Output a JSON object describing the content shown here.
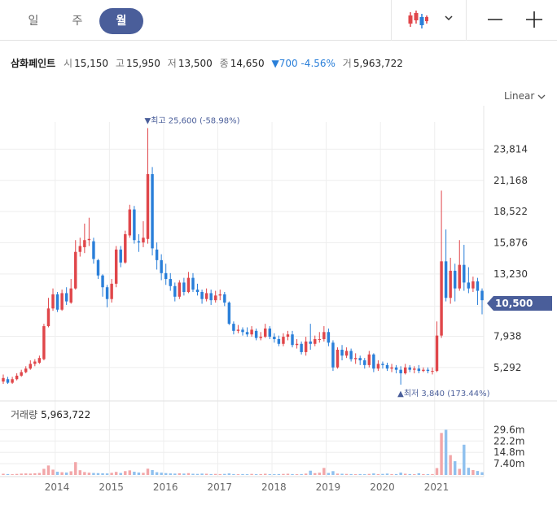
{
  "toolbar": {
    "periods": [
      {
        "label": "일",
        "active": false
      },
      {
        "label": "주",
        "active": false
      },
      {
        "label": "월",
        "active": true
      }
    ],
    "chart_type_icon": "candlestick-icon",
    "zoom_out_icon": "minus-icon",
    "zoom_in_icon": "plus-icon"
  },
  "quote": {
    "name": "삼화페인트",
    "open_label": "시",
    "open": "15,150",
    "high_label": "고",
    "high": "15,950",
    "low_label": "저",
    "low": "13,500",
    "close_label": "종",
    "close": "14,650",
    "change": "▼700 -4.56%",
    "volume_label": "거",
    "volume": "5,963,722"
  },
  "scale_mode": "Linear",
  "annotations": {
    "high": "▼최고 25,600 (-58.98%)",
    "low": "▲최저 3,840 (173.44%)"
  },
  "current_price_tag": "10,500",
  "volume_panel": {
    "label": "거래량",
    "value": "5,963,722"
  },
  "colors": {
    "up": "#e0464a",
    "down": "#2a7fd9",
    "vol_up": "#f2a6a8",
    "vol_down": "#8fc0ee",
    "accent": "#4a5e9a",
    "grid": "#eeeeee"
  },
  "chart_data": {
    "type": "candlestick",
    "y_ticks": [
      "23,814",
      "21,168",
      "18,522",
      "15,876",
      "13,230",
      "10,500",
      "7,938",
      "5,292"
    ],
    "volume_ticks": [
      "29.6m",
      "22.2m",
      "14.8m",
      "7.40m"
    ],
    "x_ticks": [
      "2014",
      "2015",
      "2016",
      "2017",
      "2018",
      "2019",
      "2020",
      "2021"
    ],
    "ylim": [
      2800,
      27500
    ],
    "volume_max_m": 33,
    "grid": true,
    "candles": [
      {
        "o": 4100,
        "c": 4400,
        "h": 4700,
        "l": 3900
      },
      {
        "o": 4300,
        "c": 4000,
        "h": 4500,
        "l": 3900
      },
      {
        "o": 4000,
        "c": 4300,
        "h": 4500,
        "l": 3900
      },
      {
        "o": 4300,
        "c": 4600,
        "h": 4800,
        "l": 4200
      },
      {
        "o": 4600,
        "c": 4900,
        "h": 5100,
        "l": 4500
      },
      {
        "o": 4900,
        "c": 5200,
        "h": 5400,
        "l": 4800
      },
      {
        "o": 5200,
        "c": 5600,
        "h": 5900,
        "l": 5100
      },
      {
        "o": 5600,
        "c": 5800,
        "h": 6000,
        "l": 5400
      },
      {
        "o": 5700,
        "c": 6100,
        "h": 6300,
        "l": 5600
      },
      {
        "o": 6000,
        "c": 8800,
        "h": 9000,
        "l": 5900
      },
      {
        "o": 8800,
        "c": 10300,
        "h": 11200,
        "l": 8700
      },
      {
        "o": 10300,
        "c": 11500,
        "h": 12000,
        "l": 10100
      },
      {
        "o": 11500,
        "c": 10200,
        "h": 11700,
        "l": 10000
      },
      {
        "o": 10200,
        "c": 11600,
        "h": 11900,
        "l": 10100
      },
      {
        "o": 11600,
        "c": 10900,
        "h": 12100,
        "l": 10600
      },
      {
        "o": 10800,
        "c": 12000,
        "h": 12800,
        "l": 10700
      },
      {
        "o": 12000,
        "c": 15100,
        "h": 16100,
        "l": 11900
      },
      {
        "o": 15100,
        "c": 15600,
        "h": 16300,
        "l": 14700
      },
      {
        "o": 15500,
        "c": 16100,
        "h": 17500,
        "l": 15000
      },
      {
        "o": 16100,
        "c": 16200,
        "h": 18000,
        "l": 15600
      },
      {
        "o": 16000,
        "c": 14500,
        "h": 16300,
        "l": 14100
      },
      {
        "o": 14400,
        "c": 13100,
        "h": 14500,
        "l": 12800
      },
      {
        "o": 13100,
        "c": 12100,
        "h": 13200,
        "l": 11300
      },
      {
        "o": 12100,
        "c": 11100,
        "h": 12300,
        "l": 10400
      },
      {
        "o": 11100,
        "c": 12400,
        "h": 12800,
        "l": 10800
      },
      {
        "o": 12400,
        "c": 15300,
        "h": 15600,
        "l": 12100
      },
      {
        "o": 15300,
        "c": 14200,
        "h": 15600,
        "l": 13800
      },
      {
        "o": 14200,
        "c": 16600,
        "h": 16900,
        "l": 14100
      },
      {
        "o": 16500,
        "c": 18700,
        "h": 19100,
        "l": 16300
      },
      {
        "o": 18700,
        "c": 16100,
        "h": 19000,
        "l": 15800
      },
      {
        "o": 16000,
        "c": 15900,
        "h": 16600,
        "l": 15100
      },
      {
        "o": 15900,
        "c": 16300,
        "h": 17700,
        "l": 15500
      },
      {
        "o": 16200,
        "c": 21700,
        "h": 25600,
        "l": 15800
      },
      {
        "o": 21700,
        "c": 15400,
        "h": 22300,
        "l": 14800
      },
      {
        "o": 15300,
        "c": 14400,
        "h": 15900,
        "l": 13600
      },
      {
        "o": 14400,
        "c": 13300,
        "h": 14900,
        "l": 12700
      },
      {
        "o": 13300,
        "c": 12800,
        "h": 14100,
        "l": 12300
      },
      {
        "o": 12800,
        "c": 12200,
        "h": 13300,
        "l": 11800
      },
      {
        "o": 12200,
        "c": 11300,
        "h": 12500,
        "l": 10900
      },
      {
        "o": 11300,
        "c": 12500,
        "h": 12700,
        "l": 11100
      },
      {
        "o": 12500,
        "c": 11700,
        "h": 12900,
        "l": 11400
      },
      {
        "o": 11700,
        "c": 12900,
        "h": 13400,
        "l": 11600
      },
      {
        "o": 12900,
        "c": 11900,
        "h": 13300,
        "l": 11700
      },
      {
        "o": 11900,
        "c": 11700,
        "h": 12400,
        "l": 11400
      },
      {
        "o": 11700,
        "c": 11100,
        "h": 11900,
        "l": 10700
      },
      {
        "o": 11100,
        "c": 11600,
        "h": 12000,
        "l": 10900
      },
      {
        "o": 11600,
        "c": 11000,
        "h": 11900,
        "l": 10600
      },
      {
        "o": 11000,
        "c": 11400,
        "h": 11800,
        "l": 10800
      },
      {
        "o": 11400,
        "c": 11500,
        "h": 11900,
        "l": 11000
      },
      {
        "o": 11500,
        "c": 10800,
        "h": 11700,
        "l": 10500
      },
      {
        "o": 10800,
        "c": 9000,
        "h": 10900,
        "l": 8900
      },
      {
        "o": 9000,
        "c": 8400,
        "h": 9200,
        "l": 8100
      },
      {
        "o": 8400,
        "c": 8500,
        "h": 8900,
        "l": 8200
      },
      {
        "o": 8500,
        "c": 8300,
        "h": 8700,
        "l": 8000
      },
      {
        "o": 8300,
        "c": 8100,
        "h": 8700,
        "l": 7900
      },
      {
        "o": 8100,
        "c": 8500,
        "h": 8800,
        "l": 7900
      },
      {
        "o": 8400,
        "c": 7800,
        "h": 8600,
        "l": 7600
      },
      {
        "o": 7800,
        "c": 7900,
        "h": 8300,
        "l": 7600
      },
      {
        "o": 7900,
        "c": 8600,
        "h": 9000,
        "l": 7800
      },
      {
        "o": 8600,
        "c": 7900,
        "h": 8800,
        "l": 7700
      },
      {
        "o": 7900,
        "c": 7700,
        "h": 8200,
        "l": 7400
      },
      {
        "o": 7700,
        "c": 7300,
        "h": 8000,
        "l": 7100
      },
      {
        "o": 7300,
        "c": 7900,
        "h": 8200,
        "l": 7100
      },
      {
        "o": 7900,
        "c": 8100,
        "h": 8400,
        "l": 7600
      },
      {
        "o": 8100,
        "c": 7200,
        "h": 8400,
        "l": 7000
      },
      {
        "o": 7200,
        "c": 7300,
        "h": 7700,
        "l": 6900
      },
      {
        "o": 7300,
        "c": 6600,
        "h": 7500,
        "l": 6400
      },
      {
        "o": 6600,
        "c": 7500,
        "h": 7900,
        "l": 6300
      },
      {
        "o": 7500,
        "c": 7300,
        "h": 9000,
        "l": 6800
      },
      {
        "o": 7300,
        "c": 7700,
        "h": 8000,
        "l": 7100
      },
      {
        "o": 7700,
        "c": 7700,
        "h": 8300,
        "l": 7400
      },
      {
        "o": 7700,
        "c": 8300,
        "h": 8800,
        "l": 7500
      },
      {
        "o": 8300,
        "c": 7400,
        "h": 8600,
        "l": 7100
      },
      {
        "o": 7400,
        "c": 5300,
        "h": 7600,
        "l": 5000
      },
      {
        "o": 5300,
        "c": 6800,
        "h": 7000,
        "l": 5200
      },
      {
        "o": 6800,
        "c": 6300,
        "h": 7200,
        "l": 5900
      },
      {
        "o": 6300,
        "c": 6700,
        "h": 7000,
        "l": 6100
      },
      {
        "o": 6700,
        "c": 6000,
        "h": 6900,
        "l": 5800
      },
      {
        "o": 6000,
        "c": 6100,
        "h": 6500,
        "l": 5600
      },
      {
        "o": 6100,
        "c": 5900,
        "h": 6300,
        "l": 5500
      },
      {
        "o": 5900,
        "c": 5500,
        "h": 6100,
        "l": 5200
      },
      {
        "o": 5500,
        "c": 6400,
        "h": 6700,
        "l": 5300
      },
      {
        "o": 6400,
        "c": 5200,
        "h": 6500,
        "l": 4900
      },
      {
        "o": 5200,
        "c": 5600,
        "h": 5900,
        "l": 5000
      },
      {
        "o": 5600,
        "c": 5500,
        "h": 5800,
        "l": 5200
      },
      {
        "o": 5500,
        "c": 5200,
        "h": 5700,
        "l": 5000
      },
      {
        "o": 5200,
        "c": 5300,
        "h": 5600,
        "l": 4900
      },
      {
        "o": 5300,
        "c": 5100,
        "h": 5500,
        "l": 4800
      },
      {
        "o": 5100,
        "c": 4800,
        "h": 5400,
        "l": 3840
      },
      {
        "o": 4800,
        "c": 5300,
        "h": 5600,
        "l": 4700
      },
      {
        "o": 5300,
        "c": 5100,
        "h": 5500,
        "l": 4900
      },
      {
        "o": 5100,
        "c": 5200,
        "h": 5400,
        "l": 4800
      },
      {
        "o": 5200,
        "c": 5000,
        "h": 5500,
        "l": 4800
      },
      {
        "o": 5000,
        "c": 5100,
        "h": 5300,
        "l": 4900
      },
      {
        "o": 5100,
        "c": 5000,
        "h": 5300,
        "l": 4800
      },
      {
        "o": 5000,
        "c": 5000,
        "h": 5300,
        "l": 4700
      },
      {
        "o": 5000,
        "c": 8000,
        "h": 9200,
        "l": 4900
      },
      {
        "o": 8000,
        "c": 14300,
        "h": 20300,
        "l": 7800
      },
      {
        "o": 14300,
        "c": 11200,
        "h": 17000,
        "l": 10900
      },
      {
        "o": 11200,
        "c": 13500,
        "h": 14600,
        "l": 10700
      },
      {
        "o": 13500,
        "c": 12000,
        "h": 14100,
        "l": 10900
      },
      {
        "o": 12000,
        "c": 14000,
        "h": 16100,
        "l": 11800
      },
      {
        "o": 14000,
        "c": 12500,
        "h": 15700,
        "l": 11800
      },
      {
        "o": 12500,
        "c": 12000,
        "h": 13800,
        "l": 11600
      },
      {
        "o": 12000,
        "c": 12600,
        "h": 13000,
        "l": 11700
      },
      {
        "o": 12600,
        "c": 11800,
        "h": 12900,
        "l": 10600
      },
      {
        "o": 11800,
        "c": 11000,
        "h": 12000,
        "l": 9800
      }
    ],
    "volumes_m": [
      0.8,
      0.6,
      0.5,
      0.7,
      0.9,
      1.0,
      0.9,
      1.1,
      1.3,
      4.0,
      6.2,
      3.5,
      2.1,
      1.8,
      1.6,
      2.4,
      8.4,
      3.1,
      1.9,
      1.5,
      1.3,
      1.2,
      1.1,
      1.0,
      1.4,
      2.0,
      1.3,
      2.5,
      3.0,
      2.1,
      1.6,
      1.4,
      4.1,
      3.2,
      1.8,
      1.5,
      1.2,
      1.0,
      0.9,
      1.1,
      0.9,
      1.2,
      0.8,
      0.7,
      0.9,
      0.8,
      0.6,
      0.7,
      0.6,
      0.7,
      1.0,
      0.6,
      0.5,
      0.6,
      0.5,
      0.7,
      0.5,
      0.6,
      0.8,
      0.5,
      0.5,
      0.6,
      0.7,
      0.8,
      0.6,
      0.5,
      0.6,
      0.9,
      2.8,
      1.2,
      1.5,
      4.6,
      1.3,
      2.5,
      0.9,
      0.8,
      0.7,
      0.6,
      0.5,
      0.6,
      0.5,
      0.7,
      1.0,
      0.6,
      0.7,
      0.9,
      0.6,
      0.6,
      1.5,
      0.8,
      0.6,
      0.5,
      1.1,
      0.6,
      0.5,
      0.6,
      4.5,
      27.5,
      29.6,
      13.0,
      9.0,
      4.0,
      19.8,
      4.7,
      3.2,
      2.6,
      1.8
    ]
  }
}
